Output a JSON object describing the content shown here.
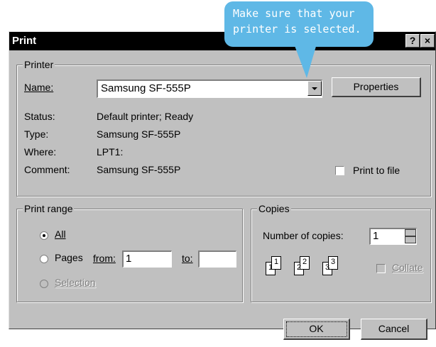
{
  "callout": {
    "line1": "Make sure that your",
    "line2": "printer is selected."
  },
  "window": {
    "title": "Print",
    "help_btn": "?",
    "close_btn": "×"
  },
  "printer": {
    "legend": "Printer",
    "name_label": "Name:",
    "name_value": "Samsung SF-555P",
    "properties_btn": "Properties",
    "status_label": "Status:",
    "status_value": "Default printer; Ready",
    "type_label": "Type:",
    "type_value": "Samsung SF-555P",
    "where_label": "Where:",
    "where_value": "LPT1:",
    "comment_label": "Comment:",
    "comment_value": "Samsung SF-555P",
    "print_to_file": "Print to file"
  },
  "range": {
    "legend": "Print range",
    "all": "All",
    "pages": "Pages",
    "from_label": "from:",
    "from_value": "1",
    "to_label": "to:",
    "to_value": "",
    "selection": "Selection"
  },
  "copies": {
    "legend": "Copies",
    "number_label": "Number of copies:",
    "number_value": "1",
    "collate": "Collate",
    "page_digits": [
      "1",
      "1",
      "2",
      "2",
      "3",
      "3"
    ]
  },
  "buttons": {
    "ok": "OK",
    "cancel": "Cancel"
  },
  "colors": {
    "callout": "#5fb8e6",
    "dialog_face": "#c0c0c0",
    "titlebar": "#000000"
  }
}
